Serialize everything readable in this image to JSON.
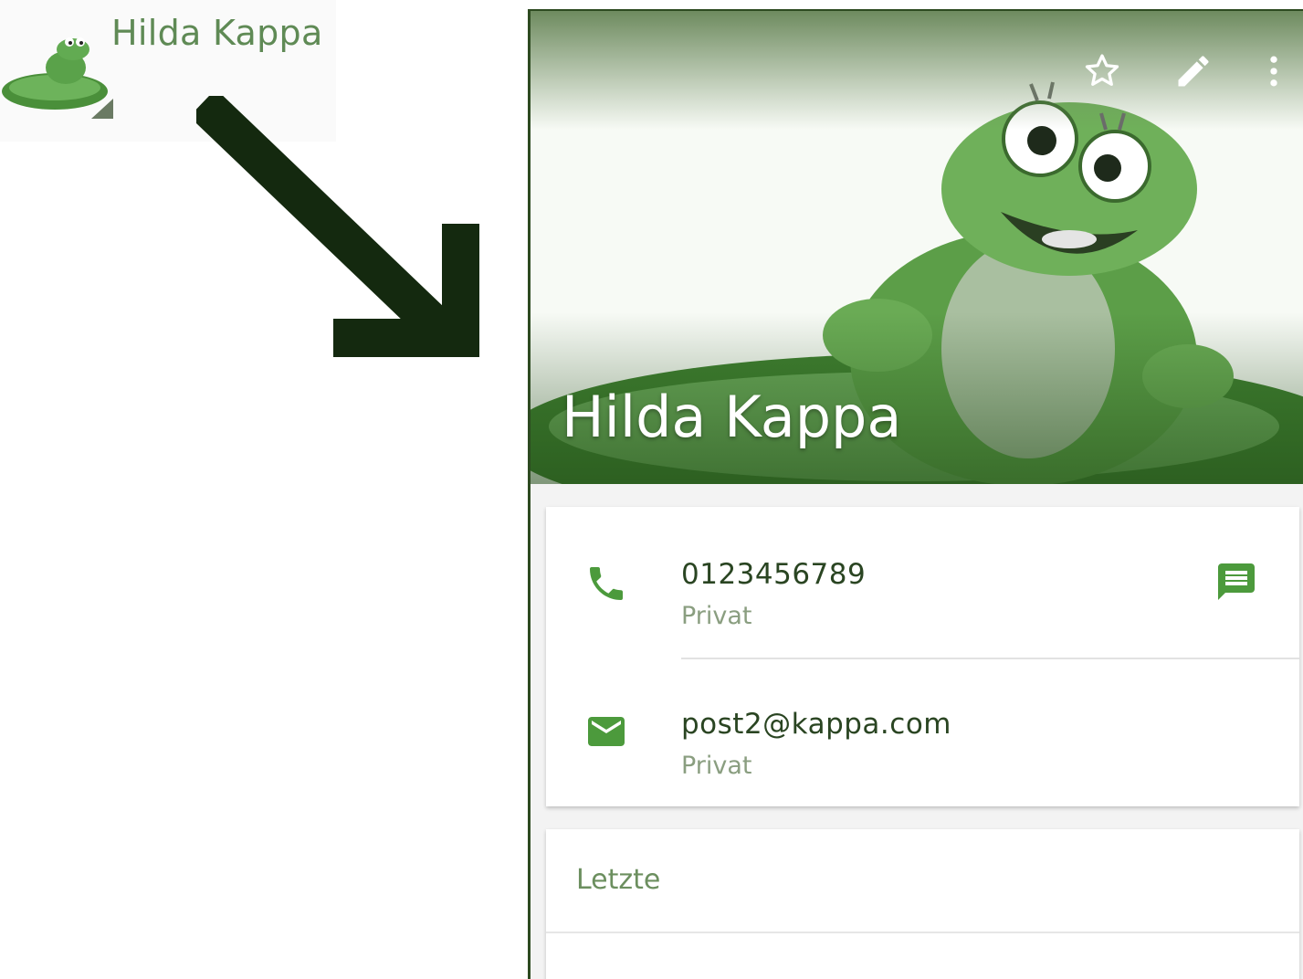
{
  "list_item": {
    "name": "Hilda Kappa"
  },
  "contact": {
    "name": "Hilda Kappa",
    "phone": {
      "number": "0123456789",
      "type": "Privat"
    },
    "email": {
      "address": "post2@kappa.com",
      "type": "Privat"
    }
  },
  "recent": {
    "title": "Letzte"
  },
  "icons": {
    "list_avatar": "frog-avatar-icon",
    "arrow": "arrow-down-right-icon",
    "favorite": "star-outline-icon",
    "edit": "pencil-icon",
    "more": "more-vert-icon",
    "phone": "phone-icon",
    "message": "message-icon",
    "email": "email-icon"
  },
  "colors": {
    "accent": "#4c9a3c",
    "dark_green": "#14290f"
  }
}
